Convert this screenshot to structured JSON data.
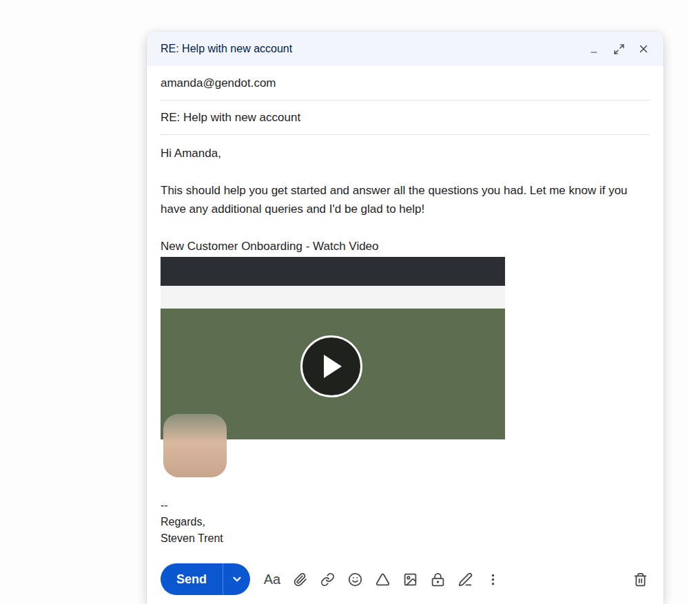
{
  "compose": {
    "title": "RE: Help with new account"
  },
  "fields": {
    "to": "amanda@gendot.com",
    "subject": "RE: Help with new account"
  },
  "body": {
    "greeting": "Hi Amanda,",
    "paragraph": "This should help you get started and answer all the questions you had. Let me know if you have any additional queries and I'd be glad to help!",
    "video": {
      "link_text": "New Customer Onboarding - Watch Video"
    },
    "signature": [
      "--",
      "Regards,",
      "Steven Trent"
    ]
  },
  "toolbar": {
    "send": "Send",
    "format": "Aa"
  }
}
